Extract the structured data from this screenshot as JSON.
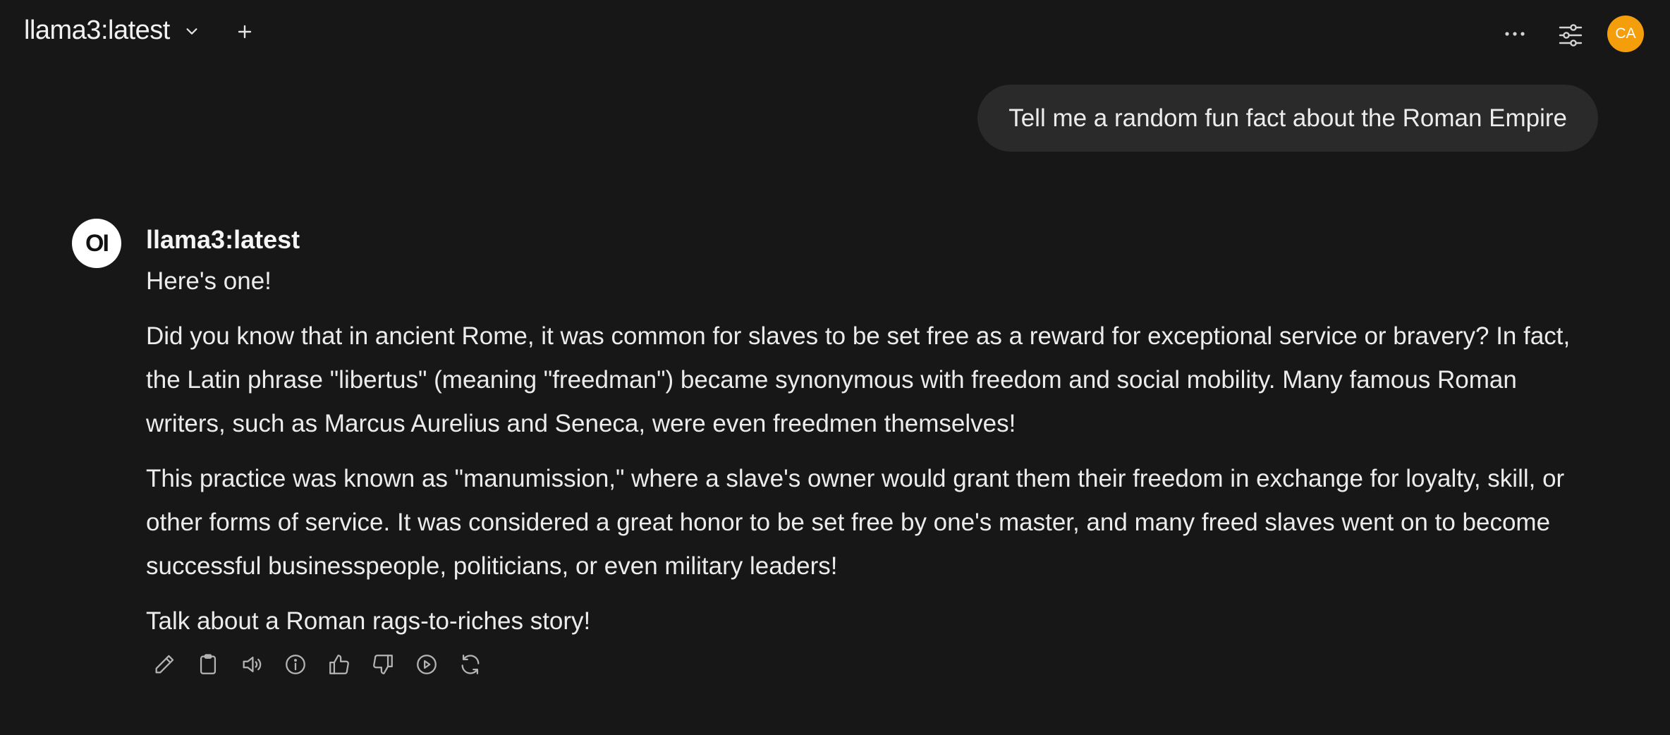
{
  "header": {
    "model_name": "llama3:latest",
    "avatar_initials": "CA",
    "avatar_color": "#f59e0b"
  },
  "chat": {
    "user_message": "Tell me a random fun fact about the Roman Empire",
    "assistant": {
      "avatar_text": "OI",
      "name": "llama3:latest",
      "paragraphs": [
        "Here's one!",
        "Did you know that in ancient Rome, it was common for slaves to be set free as a reward for exceptional service or bravery? In fact, the Latin phrase \"libertus\" (meaning \"freedman\") became synonymous with freedom and social mobility. Many famous Roman writers, such as Marcus Aurelius and Seneca, were even freedmen themselves!",
        "This practice was known as \"manumission,\" where a slave's owner would grant them their freedom in exchange for loyalty, skill, or other forms of service. It was considered a great honor to be set free by one's master, and many freed slaves went on to become successful businesspeople, politicians, or even military leaders!",
        "Talk about a Roman rags-to-riches story!"
      ]
    },
    "actions": [
      "edit-icon",
      "copy-icon",
      "speaker-icon",
      "info-icon",
      "thumbs-up-icon",
      "thumbs-down-icon",
      "play-icon",
      "regenerate-icon"
    ]
  },
  "colors": {
    "background": "#171717",
    "user_bubble": "#2a2a2a",
    "text": "#ececec",
    "icon": "#b4b4b4"
  }
}
